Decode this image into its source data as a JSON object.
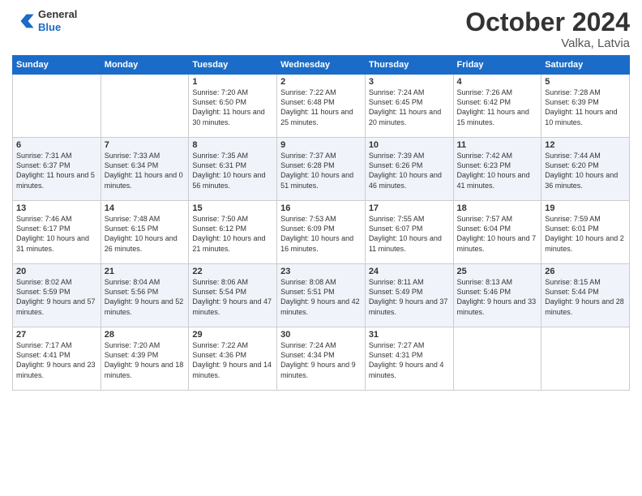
{
  "header": {
    "logo_general": "General",
    "logo_blue": "Blue",
    "month_title": "October 2024",
    "location": "Valka, Latvia"
  },
  "weekdays": [
    "Sunday",
    "Monday",
    "Tuesday",
    "Wednesday",
    "Thursday",
    "Friday",
    "Saturday"
  ],
  "weeks": [
    [
      {
        "day": "",
        "sunrise": "",
        "sunset": "",
        "daylight": ""
      },
      {
        "day": "",
        "sunrise": "",
        "sunset": "",
        "daylight": ""
      },
      {
        "day": "1",
        "sunrise": "Sunrise: 7:20 AM",
        "sunset": "Sunset: 6:50 PM",
        "daylight": "Daylight: 11 hours and 30 minutes."
      },
      {
        "day": "2",
        "sunrise": "Sunrise: 7:22 AM",
        "sunset": "Sunset: 6:48 PM",
        "daylight": "Daylight: 11 hours and 25 minutes."
      },
      {
        "day": "3",
        "sunrise": "Sunrise: 7:24 AM",
        "sunset": "Sunset: 6:45 PM",
        "daylight": "Daylight: 11 hours and 20 minutes."
      },
      {
        "day": "4",
        "sunrise": "Sunrise: 7:26 AM",
        "sunset": "Sunset: 6:42 PM",
        "daylight": "Daylight: 11 hours and 15 minutes."
      },
      {
        "day": "5",
        "sunrise": "Sunrise: 7:28 AM",
        "sunset": "Sunset: 6:39 PM",
        "daylight": "Daylight: 11 hours and 10 minutes."
      }
    ],
    [
      {
        "day": "6",
        "sunrise": "Sunrise: 7:31 AM",
        "sunset": "Sunset: 6:37 PM",
        "daylight": "Daylight: 11 hours and 5 minutes."
      },
      {
        "day": "7",
        "sunrise": "Sunrise: 7:33 AM",
        "sunset": "Sunset: 6:34 PM",
        "daylight": "Daylight: 11 hours and 0 minutes."
      },
      {
        "day": "8",
        "sunrise": "Sunrise: 7:35 AM",
        "sunset": "Sunset: 6:31 PM",
        "daylight": "Daylight: 10 hours and 56 minutes."
      },
      {
        "day": "9",
        "sunrise": "Sunrise: 7:37 AM",
        "sunset": "Sunset: 6:28 PM",
        "daylight": "Daylight: 10 hours and 51 minutes."
      },
      {
        "day": "10",
        "sunrise": "Sunrise: 7:39 AM",
        "sunset": "Sunset: 6:26 PM",
        "daylight": "Daylight: 10 hours and 46 minutes."
      },
      {
        "day": "11",
        "sunrise": "Sunrise: 7:42 AM",
        "sunset": "Sunset: 6:23 PM",
        "daylight": "Daylight: 10 hours and 41 minutes."
      },
      {
        "day": "12",
        "sunrise": "Sunrise: 7:44 AM",
        "sunset": "Sunset: 6:20 PM",
        "daylight": "Daylight: 10 hours and 36 minutes."
      }
    ],
    [
      {
        "day": "13",
        "sunrise": "Sunrise: 7:46 AM",
        "sunset": "Sunset: 6:17 PM",
        "daylight": "Daylight: 10 hours and 31 minutes."
      },
      {
        "day": "14",
        "sunrise": "Sunrise: 7:48 AM",
        "sunset": "Sunset: 6:15 PM",
        "daylight": "Daylight: 10 hours and 26 minutes."
      },
      {
        "day": "15",
        "sunrise": "Sunrise: 7:50 AM",
        "sunset": "Sunset: 6:12 PM",
        "daylight": "Daylight: 10 hours and 21 minutes."
      },
      {
        "day": "16",
        "sunrise": "Sunrise: 7:53 AM",
        "sunset": "Sunset: 6:09 PM",
        "daylight": "Daylight: 10 hours and 16 minutes."
      },
      {
        "day": "17",
        "sunrise": "Sunrise: 7:55 AM",
        "sunset": "Sunset: 6:07 PM",
        "daylight": "Daylight: 10 hours and 11 minutes."
      },
      {
        "day": "18",
        "sunrise": "Sunrise: 7:57 AM",
        "sunset": "Sunset: 6:04 PM",
        "daylight": "Daylight: 10 hours and 7 minutes."
      },
      {
        "day": "19",
        "sunrise": "Sunrise: 7:59 AM",
        "sunset": "Sunset: 6:01 PM",
        "daylight": "Daylight: 10 hours and 2 minutes."
      }
    ],
    [
      {
        "day": "20",
        "sunrise": "Sunrise: 8:02 AM",
        "sunset": "Sunset: 5:59 PM",
        "daylight": "Daylight: 9 hours and 57 minutes."
      },
      {
        "day": "21",
        "sunrise": "Sunrise: 8:04 AM",
        "sunset": "Sunset: 5:56 PM",
        "daylight": "Daylight: 9 hours and 52 minutes."
      },
      {
        "day": "22",
        "sunrise": "Sunrise: 8:06 AM",
        "sunset": "Sunset: 5:54 PM",
        "daylight": "Daylight: 9 hours and 47 minutes."
      },
      {
        "day": "23",
        "sunrise": "Sunrise: 8:08 AM",
        "sunset": "Sunset: 5:51 PM",
        "daylight": "Daylight: 9 hours and 42 minutes."
      },
      {
        "day": "24",
        "sunrise": "Sunrise: 8:11 AM",
        "sunset": "Sunset: 5:49 PM",
        "daylight": "Daylight: 9 hours and 37 minutes."
      },
      {
        "day": "25",
        "sunrise": "Sunrise: 8:13 AM",
        "sunset": "Sunset: 5:46 PM",
        "daylight": "Daylight: 9 hours and 33 minutes."
      },
      {
        "day": "26",
        "sunrise": "Sunrise: 8:15 AM",
        "sunset": "Sunset: 5:44 PM",
        "daylight": "Daylight: 9 hours and 28 minutes."
      }
    ],
    [
      {
        "day": "27",
        "sunrise": "Sunrise: 7:17 AM",
        "sunset": "Sunset: 4:41 PM",
        "daylight": "Daylight: 9 hours and 23 minutes."
      },
      {
        "day": "28",
        "sunrise": "Sunrise: 7:20 AM",
        "sunset": "Sunset: 4:39 PM",
        "daylight": "Daylight: 9 hours and 18 minutes."
      },
      {
        "day": "29",
        "sunrise": "Sunrise: 7:22 AM",
        "sunset": "Sunset: 4:36 PM",
        "daylight": "Daylight: 9 hours and 14 minutes."
      },
      {
        "day": "30",
        "sunrise": "Sunrise: 7:24 AM",
        "sunset": "Sunset: 4:34 PM",
        "daylight": "Daylight: 9 hours and 9 minutes."
      },
      {
        "day": "31",
        "sunrise": "Sunrise: 7:27 AM",
        "sunset": "Sunset: 4:31 PM",
        "daylight": "Daylight: 9 hours and 4 minutes."
      },
      {
        "day": "",
        "sunrise": "",
        "sunset": "",
        "daylight": ""
      },
      {
        "day": "",
        "sunrise": "",
        "sunset": "",
        "daylight": ""
      }
    ]
  ]
}
